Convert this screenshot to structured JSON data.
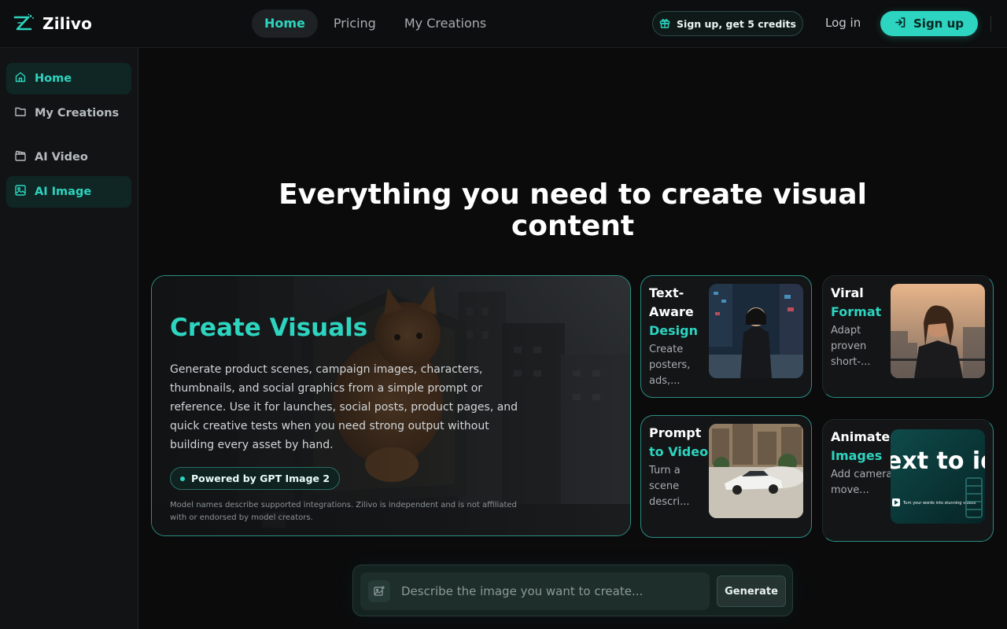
{
  "brand": {
    "name": "Zilivo",
    "icon": "zilivo-logo-icon",
    "accent": "#2dd4bf"
  },
  "topnav": {
    "items": [
      {
        "label": "Home",
        "active": true
      },
      {
        "label": "Pricing",
        "active": false
      },
      {
        "label": "My Creations",
        "active": false
      }
    ]
  },
  "header": {
    "credits_label": "Sign up, get 5 credits",
    "credits_icon": "gift-icon",
    "login_label": "Log in",
    "signup_label": "Sign up",
    "signup_icon": "sign-in-icon"
  },
  "sidebar": {
    "items": [
      {
        "label": "Home",
        "icon": "home-icon",
        "active": true
      },
      {
        "label": "My Creations",
        "icon": "folder-icon",
        "active": false
      },
      {
        "label": "AI Video",
        "icon": "clapperboard-icon",
        "active": false
      },
      {
        "label": "AI Image",
        "icon": "image-icon",
        "active": true
      }
    ]
  },
  "hero": {
    "title": "Everything you need to create visual content"
  },
  "main_card": {
    "title": "Create Visuals",
    "description": "Generate product scenes, campaign images, characters, thumbnails, and social graphics from a simple prompt or reference. Use it for launches, social posts, product pages, and quick creative tests when you need strong output without building every asset by hand.",
    "badge": "Powered by GPT Image 2",
    "disclaimer": "Model names describe supported integrations. Zilivo is independent and is not affiliated with or endorsed by model creators."
  },
  "feature_cards": [
    {
      "title_plain": "Text-Aware",
      "title_accent": "Design",
      "description": "Create posters, ads,...",
      "thumb": "city-night-portrait-image"
    },
    {
      "title_plain": "Viral",
      "title_accent": "Format",
      "description": "Adapt proven short-...",
      "thumb": "rooftop-portrait-image"
    },
    {
      "title_plain": "Prompt",
      "title_accent": "to Video",
      "description": "Turn a scene descri...",
      "thumb": "drifting-car-image"
    },
    {
      "title_plain": "Animate",
      "title_accent": "Images",
      "description": "Add camera move...",
      "thumb": "text-to-video-banner-image",
      "thumb_text": "ext to ideo",
      "thumb_caption": "Turn your words into stunning videos"
    }
  ],
  "prompt": {
    "placeholder": "Describe the image you want to create...",
    "value": "",
    "generate_label": "Generate",
    "icon": "image-add-icon"
  }
}
